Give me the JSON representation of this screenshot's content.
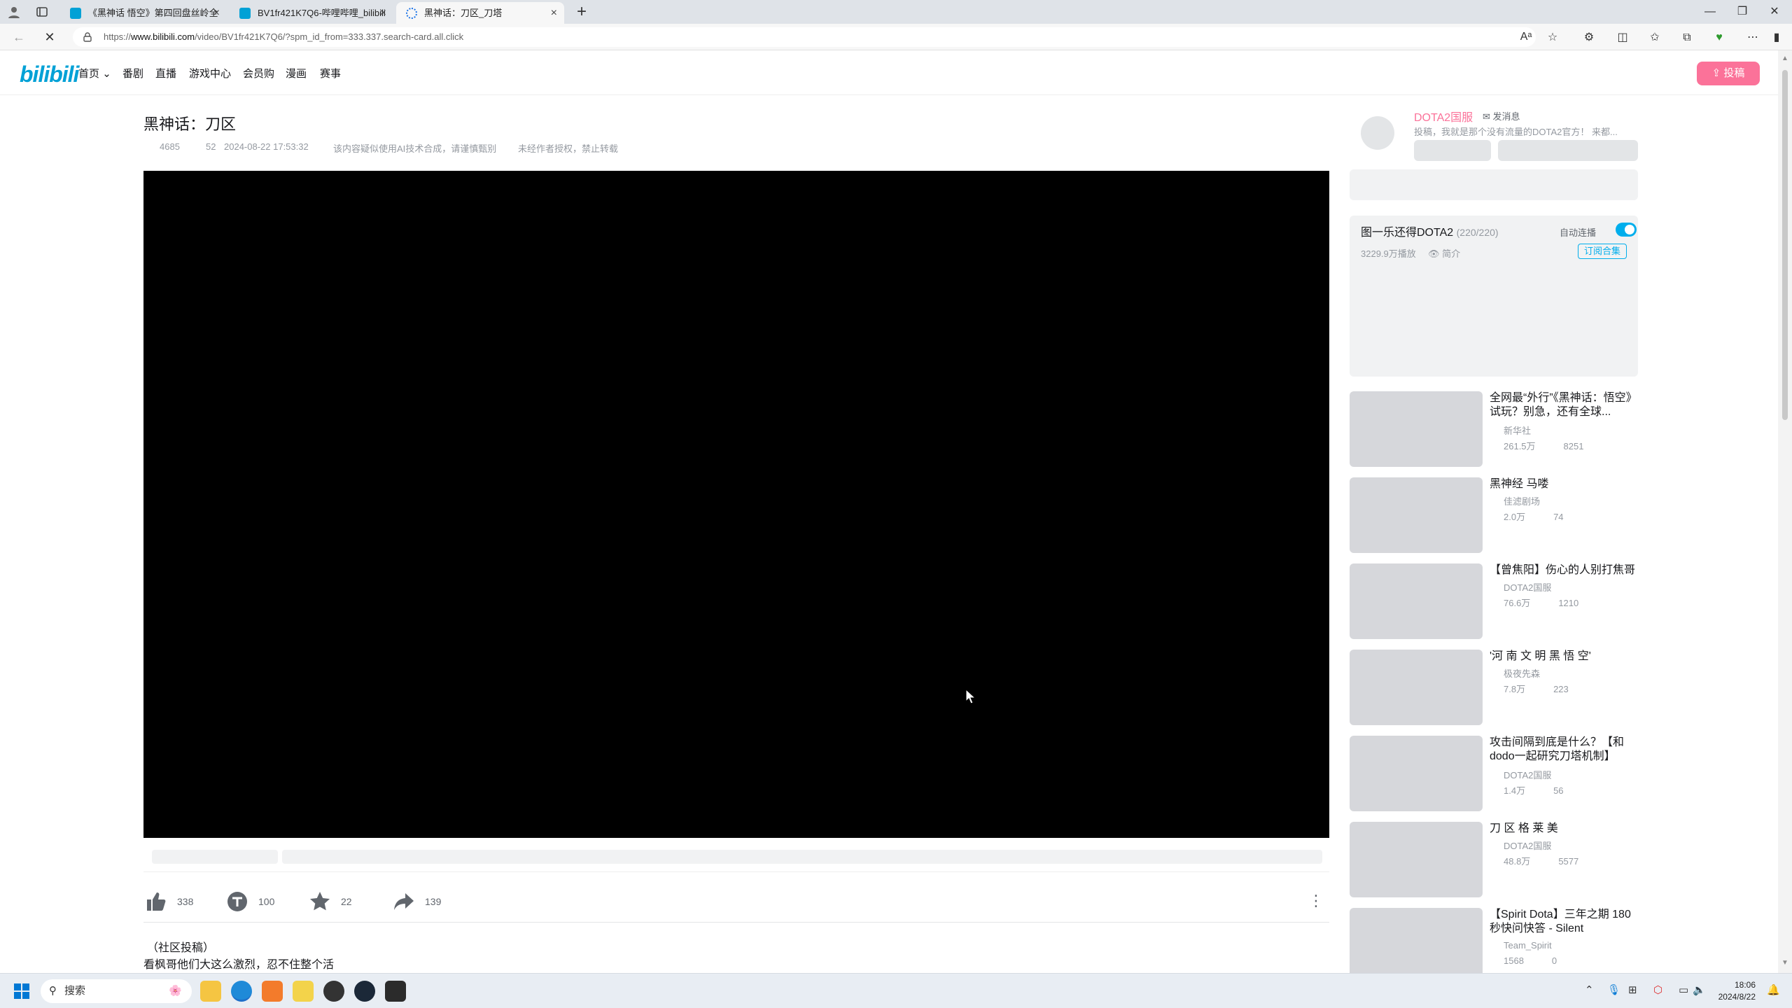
{
  "browser": {
    "tabs": [
      {
        "title": "《黑神话 悟空》第四回盘丝岭全",
        "active": false
      },
      {
        "title": "BV1fr421K7Q6-哔哩哔哩_bilibili",
        "active": false
      },
      {
        "title": "黑神话：刀区_刀塔",
        "active": true
      }
    ],
    "url_prefix": "https://",
    "url_host": "www.bilibili.com",
    "url_path": "/video/BV1fr421K7Q6/?spm_id_from=333.337.search-card.all.click"
  },
  "header": {
    "logo": "bilibili",
    "nav": [
      "首页",
      "番剧",
      "直播",
      "游戏中心",
      "会员购",
      "漫画",
      "赛事"
    ],
    "upload_label": "投稿"
  },
  "video": {
    "title": "黑神话：刀区",
    "views": "4685",
    "danmaku": "52",
    "date": "2024-08-22 17:53:32",
    "ai_notice": "该内容疑似使用AI技术合成，请谨慎甄别",
    "copyright": "未经作者授权，禁止转载",
    "likes": "338",
    "coins": "100",
    "favorites": "22",
    "shares": "139",
    "tag_line": "（社区投稿）",
    "description": "看枫哥他们大这么激烈，忍不住整个活"
  },
  "uploader": {
    "name": "DOTA2国服",
    "message_label": "发消息",
    "sign": "投稿，我就是那个没有流量的DOTA2官方！ 来都..."
  },
  "collection": {
    "title": "图一乐还得DOTA2",
    "count": "(220/220)",
    "autoplay_label": "自动连播",
    "views": "3229.9万播放",
    "intro_label": "简介",
    "subscribe_label": "订阅合集"
  },
  "recommendations": [
    {
      "title": "全网最“外行”《黑神话：悟空》试玩？别急，还有全球...",
      "author": "新华社",
      "views": "261.5万",
      "danmaku": "8251"
    },
    {
      "title": "黑神经 马喽",
      "author": "佳滤剧场",
      "views": "2.0万",
      "danmaku": "74"
    },
    {
      "title": "【曾焦阳】伤心的人别打焦哥",
      "author": "DOTA2国服",
      "views": "76.6万",
      "danmaku": "1210"
    },
    {
      "title": "'河 南 文 明 黑 悟 空'",
      "author": "极夜先森",
      "views": "7.8万",
      "danmaku": "223"
    },
    {
      "title": "攻击间隔到底是什么？【和dodo一起研究刀塔机制】",
      "author": "DOTA2国服",
      "views": "1.4万",
      "danmaku": "56"
    },
    {
      "title": "刀 区 格 莱 美",
      "author": "DOTA2国服",
      "views": "48.8万",
      "danmaku": "5577"
    },
    {
      "title": "【Spirit Dota】三年之期 180秒快问快答 - Silent",
      "author": "Team_Spirit",
      "views": "1568",
      "danmaku": "0"
    }
  ],
  "taskbar": {
    "search_label": "搜索",
    "time": "18:06",
    "date": "2024/8/22"
  },
  "colors": {
    "brand": "#00a1d6",
    "pink": "#fb7299",
    "accent": "#00aeec"
  }
}
